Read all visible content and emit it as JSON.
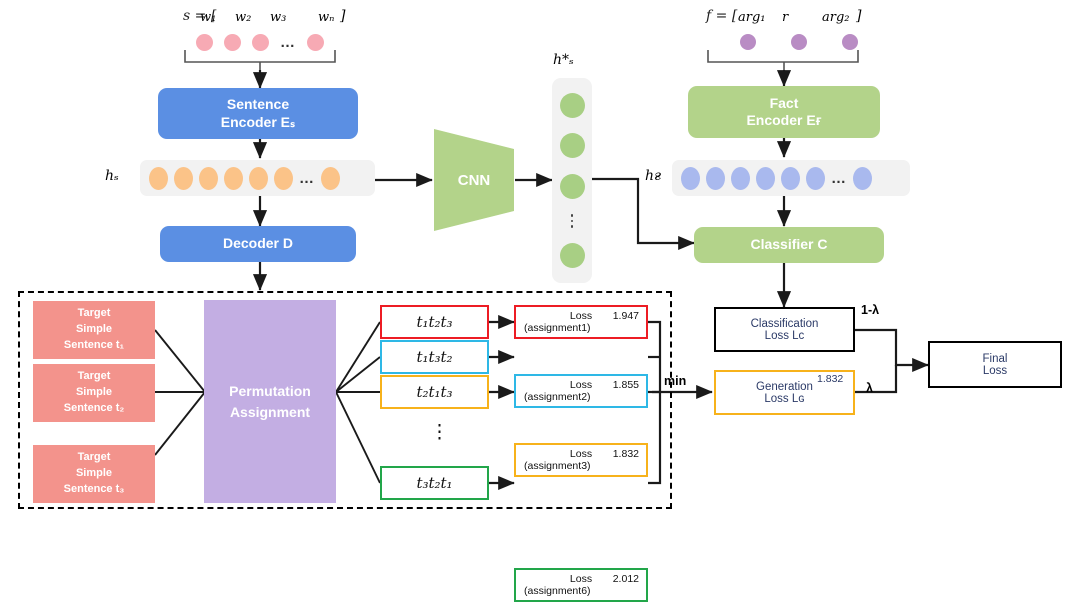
{
  "inputs": {
    "sentence": {
      "name": "sentence-input",
      "notation_prefix": "s = [",
      "tokens": [
        "w₁",
        "w₂",
        "w₃",
        "wₙ"
      ],
      "ellipsis": "…",
      "notation_suffix": "]",
      "dot_color": "#f7aab4",
      "dot_count": 4
    },
    "fact": {
      "name": "fact-input",
      "notation_prefix": "f = [",
      "tokens": [
        "arg₁",
        "r",
        "arg₂"
      ],
      "notation_suffix": "]",
      "dot_color": "#b98cc4",
      "dot_count": 3
    }
  },
  "modules": {
    "sentence_encoder": {
      "line1": "Sentence",
      "line2": "Encoder Eₛ",
      "color": "#5b8fe3"
    },
    "fact_encoder": {
      "line1": "Fact",
      "line2": "Encoder Eғ",
      "color": "#b3d38a"
    },
    "decoder": {
      "label": "Decoder D",
      "color": "#5b8fe3"
    },
    "classifier": {
      "label": "Classifier C",
      "color": "#b3d38a"
    },
    "cnn": {
      "label": "CNN",
      "color": "#b3d38a"
    }
  },
  "hidden_states": {
    "h_s": {
      "label": "hₛ",
      "dot_color": "#fbc388",
      "dot_count": 6,
      "ellipsis": "…",
      "tail_dots": 1
    },
    "h_f": {
      "label": "hғ",
      "dot_color": "#a9b9ee",
      "dot_count": 6,
      "ellipsis": "…",
      "tail_dots": 1
    },
    "h_s_star": {
      "label": "h*ₛ",
      "dot_color": "#a8cf84",
      "top_dots": 3,
      "bottom_dots": 1
    }
  },
  "permutation_block": {
    "title": "Permutation Assignment",
    "title_line1": "Permutation",
    "title_line2": "Assignment",
    "color": "#c3aee3",
    "targets": [
      {
        "line1": "Target",
        "line2": "Simple",
        "line3": "Sentence t₁",
        "color": "#f3938c"
      },
      {
        "line1": "Target",
        "line2": "Simple",
        "line3": "Sentence t₂",
        "color": "#f3938c"
      },
      {
        "line1": "Target",
        "line2": "Simple",
        "line3": "Sentence t₃",
        "color": "#f3938c"
      }
    ],
    "vertical_ellipsis": "⋮",
    "rows": [
      {
        "perm": "t₁t₂t₃",
        "loss_word": "Loss",
        "loss_value": "1.947",
        "assignment": "(assignment1)",
        "color": "#ed1c24"
      },
      {
        "perm": "t₁t₃t₂",
        "loss_word": "Loss",
        "loss_value": "1.855",
        "assignment": "(assignment2)",
        "color": "#2eb8e6"
      },
      {
        "perm": "t₂t₁t₃",
        "loss_word": "Loss",
        "loss_value": "1.832",
        "assignment": "(assignment3)",
        "color": "#f7b21b"
      },
      {
        "perm": "t₃t₂t₁",
        "loss_word": "Loss",
        "loss_value": "2.012",
        "assignment": "(assignment6)",
        "color": "#22a64a"
      }
    ],
    "min_label": "min"
  },
  "losses": {
    "classification": {
      "line1": "Classification",
      "line2": "Loss Lᴄ",
      "weight": "1-λ",
      "border": "#000000"
    },
    "generation": {
      "line1": "Generation",
      "line2": "Loss Lɢ",
      "value": "1.832",
      "weight": "λ",
      "border": "#f7b21b"
    },
    "final": {
      "line1": "Final",
      "line2": "Loss",
      "border": "#000000"
    }
  }
}
